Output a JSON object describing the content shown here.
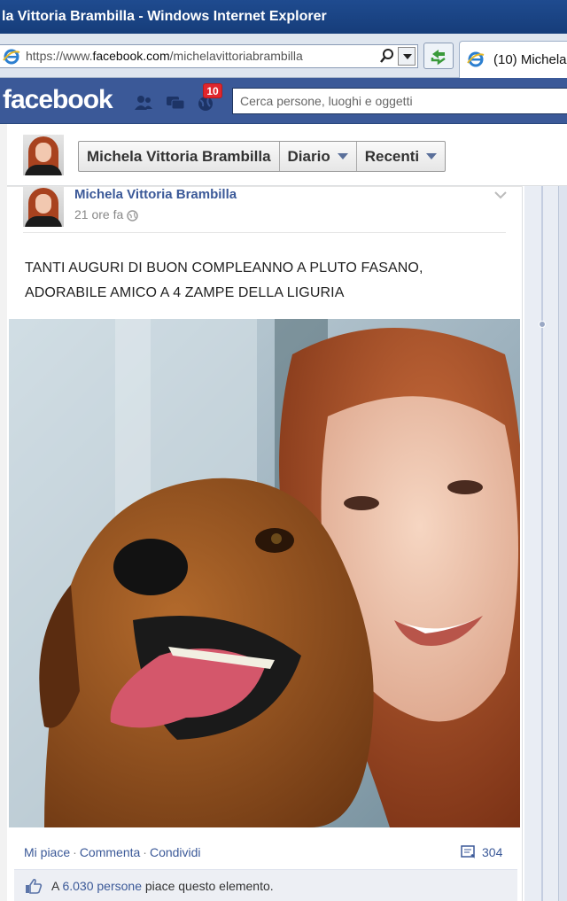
{
  "window": {
    "title": "la Vittoria Brambilla - Windows Internet Explorer"
  },
  "browser": {
    "url_prefix": "https://www.",
    "url_domain": "facebook.com",
    "url_path": "/michelavittoriabrambilla",
    "tab_label": "(10) Michela"
  },
  "fb": {
    "logo": "facebook",
    "notifications_count": "10",
    "search_placeholder": "Cerca persone, luoghi e oggetti",
    "colors": {
      "brand": "#3b5998",
      "badge": "#e0262d"
    }
  },
  "profile": {
    "name": "Michela Vittoria Brambilla",
    "nav": {
      "timeline": "Diario",
      "recent": "Recenti"
    }
  },
  "post": {
    "author": "Michela Vittoria Brambilla",
    "time": "21 ore fa",
    "text_line1": "TANTI AUGURI DI BUON COMPLEANNO A PLUTO FASANO,",
    "text_line2": "ADORABILE AMICO A 4 ZAMPE DELLA LIGURIA",
    "actions": {
      "like": "Mi piace",
      "comment": "Commenta",
      "share": "Condividi"
    },
    "shares": "304",
    "likes": {
      "prefix": "A",
      "count_link": "6.030 persone",
      "suffix": "piace questo elemento."
    }
  }
}
